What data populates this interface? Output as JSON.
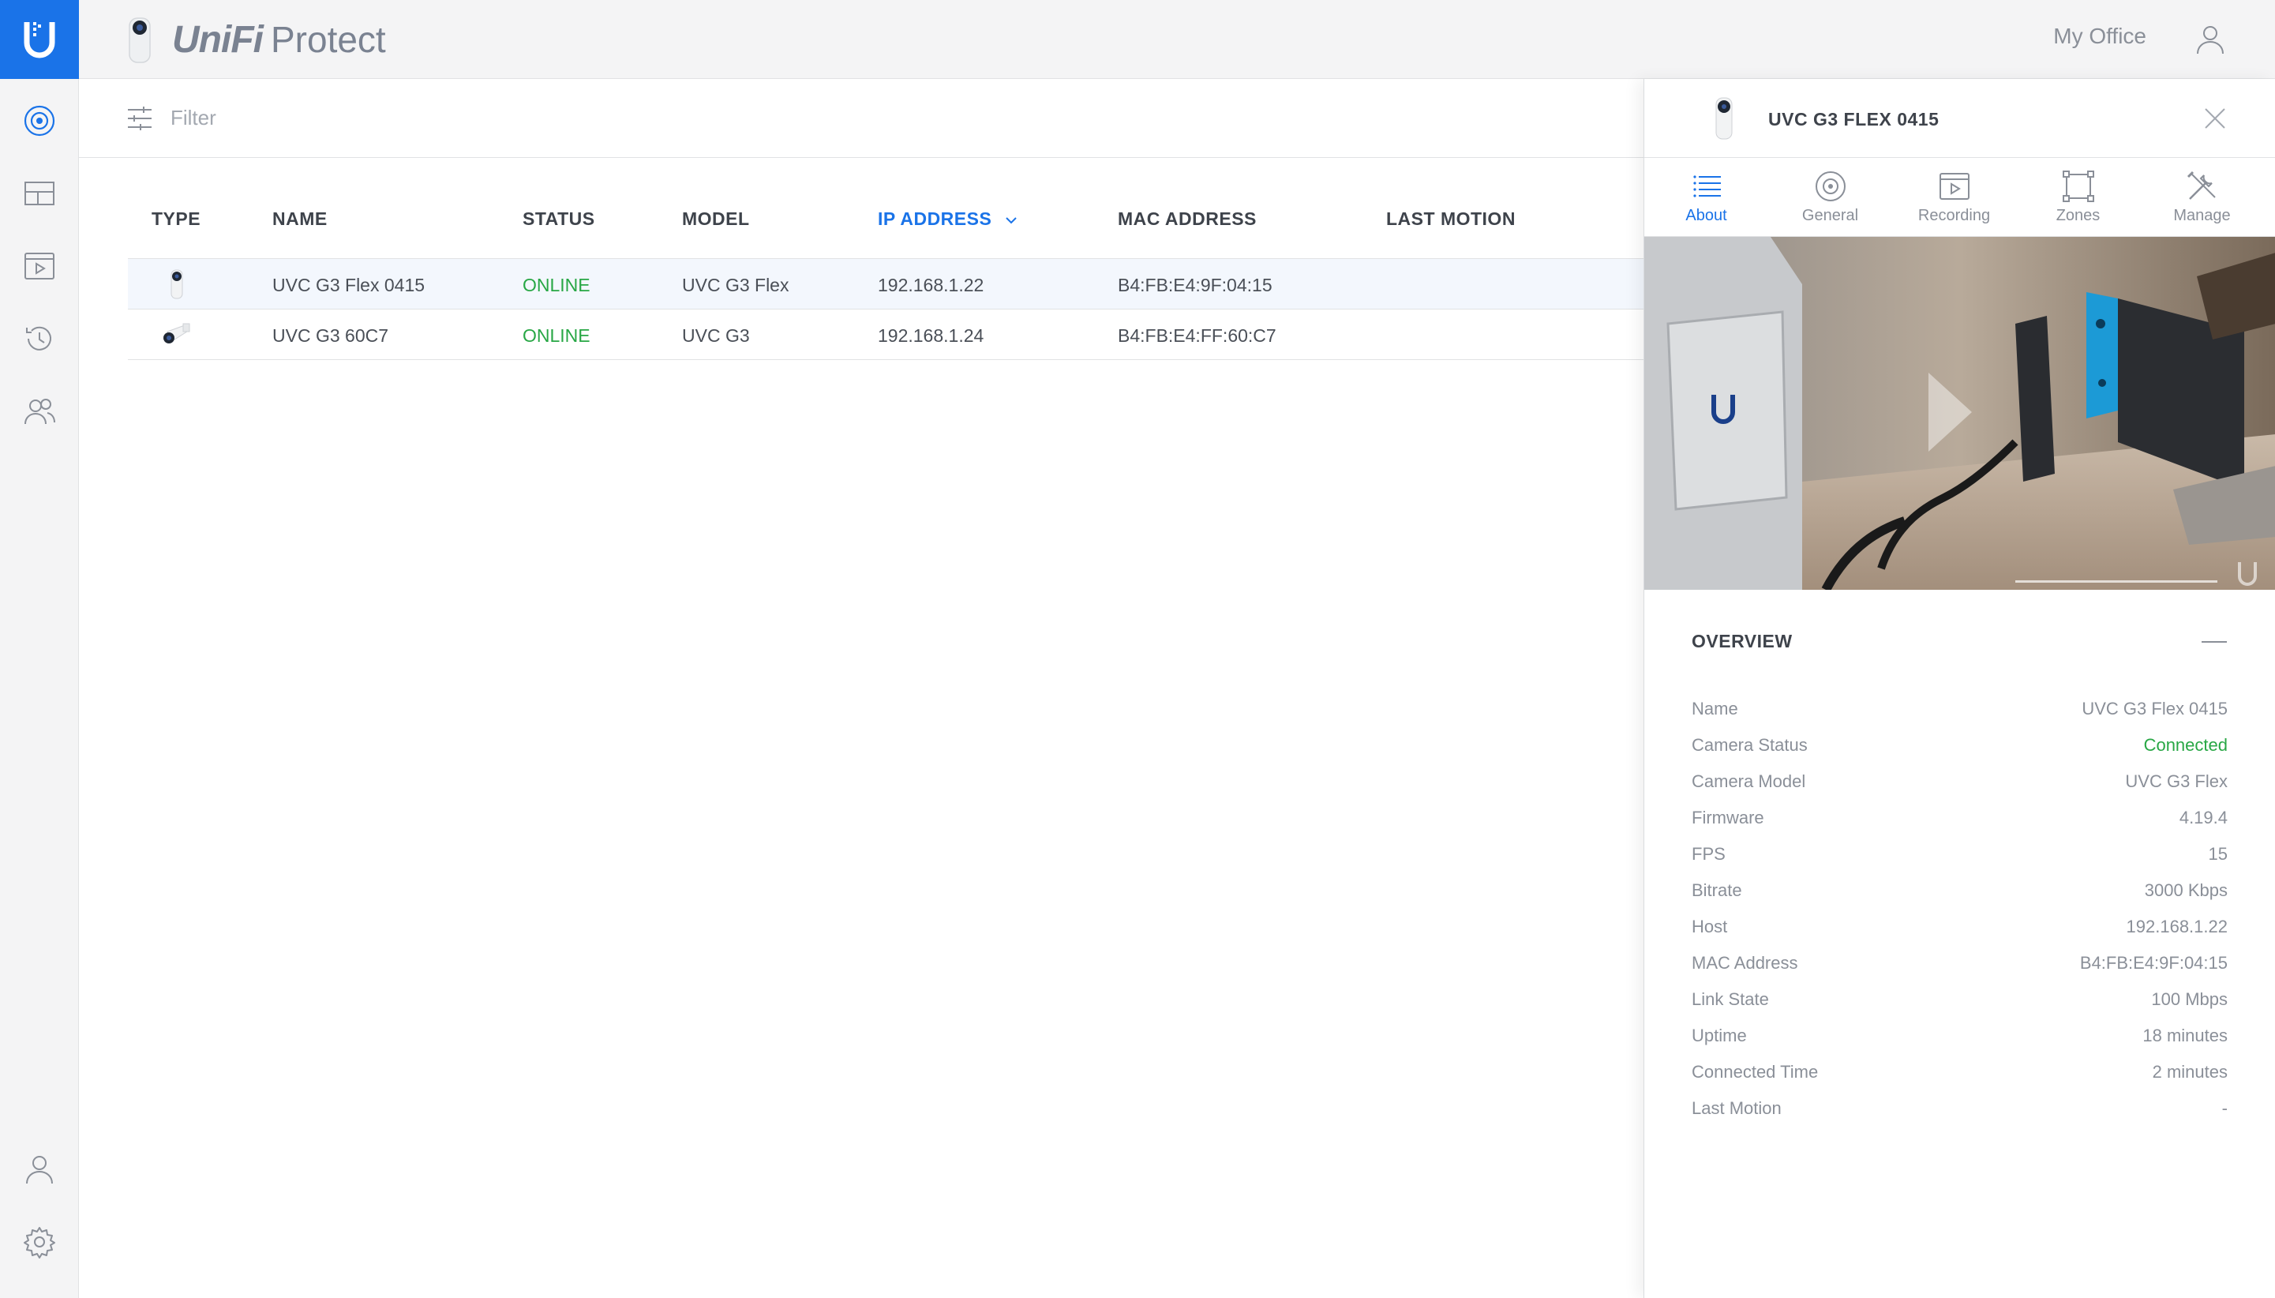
{
  "app": {
    "brand_unifi": "UniFi",
    "brand_protect": "Protect",
    "site_name": "My Office",
    "accent_color": "#1a73e8",
    "online_color": "#28a745"
  },
  "rail": {
    "items": [
      {
        "icon": "camera-icon"
      },
      {
        "icon": "liveview-grid-icon"
      },
      {
        "icon": "video-player-icon"
      },
      {
        "icon": "history-icon"
      },
      {
        "icon": "users-icon"
      }
    ],
    "bottom": [
      {
        "icon": "account-icon"
      },
      {
        "icon": "settings-gear-icon"
      }
    ]
  },
  "filter": {
    "placeholder": "Filter"
  },
  "table": {
    "columns": [
      "TYPE",
      "NAME",
      "STATUS",
      "MODEL",
      "IP ADDRESS",
      "MAC ADDRESS",
      "LAST MOTION"
    ],
    "sorted_column": "IP ADDRESS",
    "rows": [
      {
        "type_icon": "g3-flex-camera-icon",
        "name": "UVC G3 Flex 0415",
        "status": "ONLINE",
        "model": "UVC G3 Flex",
        "ip": "192.168.1.22",
        "mac": "B4:FB:E4:9F:04:15",
        "last_motion": ""
      },
      {
        "type_icon": "g3-bullet-camera-icon",
        "name": "UVC G3 60C7",
        "status": "ONLINE",
        "model": "UVC G3",
        "ip": "192.168.1.24",
        "mac": "B4:FB:E4:FF:60:C7",
        "last_motion": ""
      }
    ]
  },
  "panel": {
    "title": "UVC G3 FLEX 0415",
    "tabs": [
      "About",
      "General",
      "Recording",
      "Zones",
      "Manage"
    ],
    "active_tab": "About",
    "overview": {
      "title": "OVERVIEW",
      "rows": [
        {
          "key": "Name",
          "value": "UVC G3 Flex 0415"
        },
        {
          "key": "Camera Status",
          "value": "Connected"
        },
        {
          "key": "Camera Model",
          "value": "UVC G3 Flex"
        },
        {
          "key": "Firmware",
          "value": "4.19.4"
        },
        {
          "key": "FPS",
          "value": "15"
        },
        {
          "key": "Bitrate",
          "value": "3000 Kbps"
        },
        {
          "key": "Host",
          "value": "192.168.1.22"
        },
        {
          "key": "MAC Address",
          "value": "B4:FB:E4:9F:04:15"
        },
        {
          "key": "Link State",
          "value": "100 Mbps"
        },
        {
          "key": "Uptime",
          "value": "18 minutes"
        },
        {
          "key": "Connected Time",
          "value": "2 minutes"
        },
        {
          "key": "Last Motion",
          "value": "-"
        }
      ]
    }
  }
}
